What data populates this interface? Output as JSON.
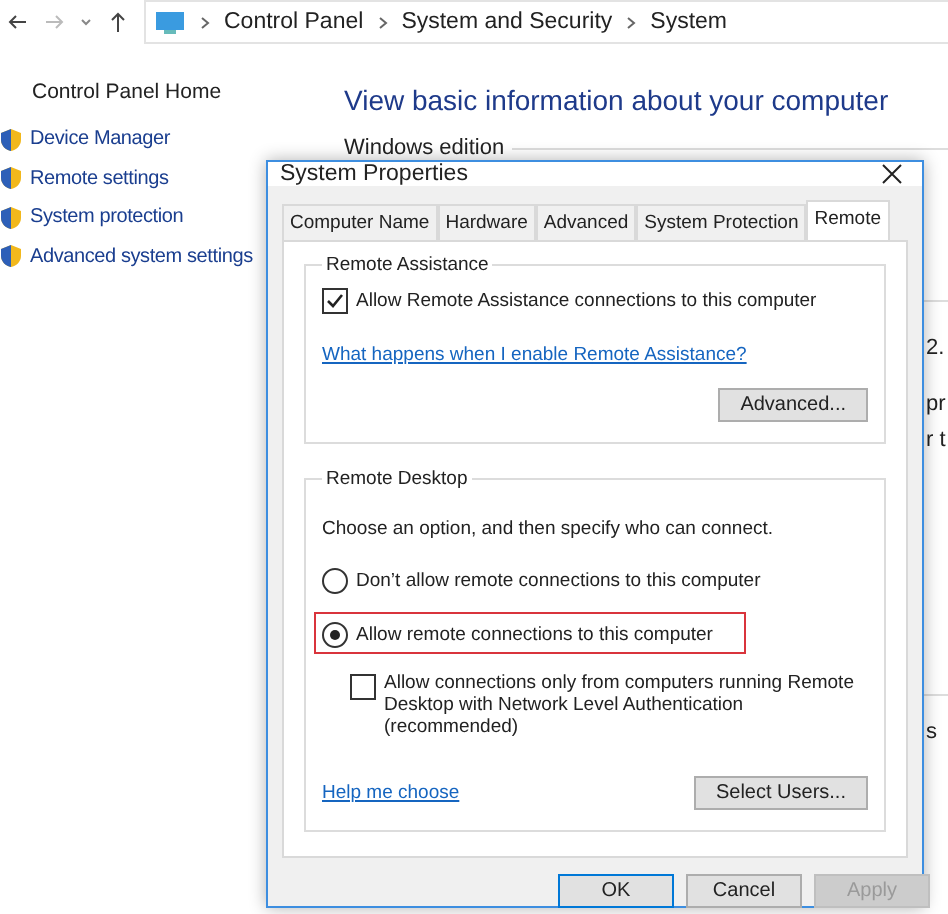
{
  "address_bar": {
    "path": [
      "Control Panel",
      "System and Security",
      "System"
    ]
  },
  "sidebar": {
    "home": "Control Panel Home",
    "items": [
      "Device Manager",
      "Remote settings",
      "System protection",
      "Advanced system settings"
    ]
  },
  "main": {
    "heading": "View basic information about your computer",
    "section": "Windows edition",
    "fragments": [
      "2.",
      "pr",
      "r t",
      "s"
    ]
  },
  "dialog": {
    "title": "System Properties",
    "tabs": [
      {
        "label": "Computer Name",
        "selected": false
      },
      {
        "label": "Hardware",
        "selected": false
      },
      {
        "label": "Advanced",
        "selected": false
      },
      {
        "label": "System Protection",
        "selected": false
      },
      {
        "label": "Remote",
        "selected": true
      }
    ],
    "remote_assistance": {
      "title": "Remote Assistance",
      "allow": {
        "label": "Allow Remote Assistance connections to this computer",
        "checked": true
      },
      "link": "What happens when I enable Remote Assistance?",
      "button": "Advanced..."
    },
    "remote_desktop": {
      "title": "Remote Desktop",
      "intro": "Choose an option, and then specify who can connect.",
      "options": [
        {
          "label": "Don’t allow remote connections to this computer",
          "selected": false,
          "highlighted": false
        },
        {
          "label": "Allow remote connections to this computer",
          "selected": true,
          "highlighted": true
        }
      ],
      "nla": {
        "label": "Allow connections only from computers running Remote Desktop with Network Level Authentication (recommended)",
        "checked": false
      },
      "help_link": "Help me choose",
      "button": "Select Users..."
    },
    "buttons": [
      {
        "label": "OK",
        "default": true,
        "disabled": false
      },
      {
        "label": "Cancel",
        "default": false,
        "disabled": false
      },
      {
        "label": "Apply",
        "default": false,
        "disabled": true
      }
    ]
  }
}
